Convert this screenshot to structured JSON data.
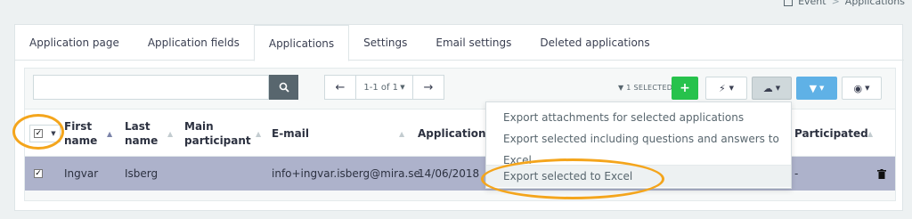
{
  "breadcrumb": {
    "items": [
      "Event",
      "Applications"
    ],
    "separator": ">"
  },
  "tabs": [
    {
      "label": "Application page"
    },
    {
      "label": "Application fields"
    },
    {
      "label": "Applications"
    },
    {
      "label": "Settings"
    },
    {
      "label": "Email settings"
    },
    {
      "label": "Deleted applications"
    }
  ],
  "search": {
    "value": "",
    "placeholder": ""
  },
  "pager": {
    "label": "1-1 of 1"
  },
  "selection": {
    "count_label": "1 SELECTED"
  },
  "table": {
    "headers": [
      "First name",
      "Last name",
      "Main participant",
      "E-mail",
      "Application da",
      "Participated"
    ],
    "rows": [
      {
        "first_name": "Ingvar",
        "last_name": "Isberg",
        "email": "info+ingvar.isberg@mira.se",
        "application_date": "14/06/2018",
        "participated": "-"
      }
    ]
  },
  "export_menu": {
    "items": [
      "Export attachments for selected applications",
      "Export selected including questions and answers to Excel",
      "Export selected to Excel"
    ]
  },
  "colors": {
    "accent_green": "#27c24c",
    "accent_blue": "#5fb1e6",
    "row_selected": "#adb2cb",
    "annotation": "#f4a51c"
  }
}
